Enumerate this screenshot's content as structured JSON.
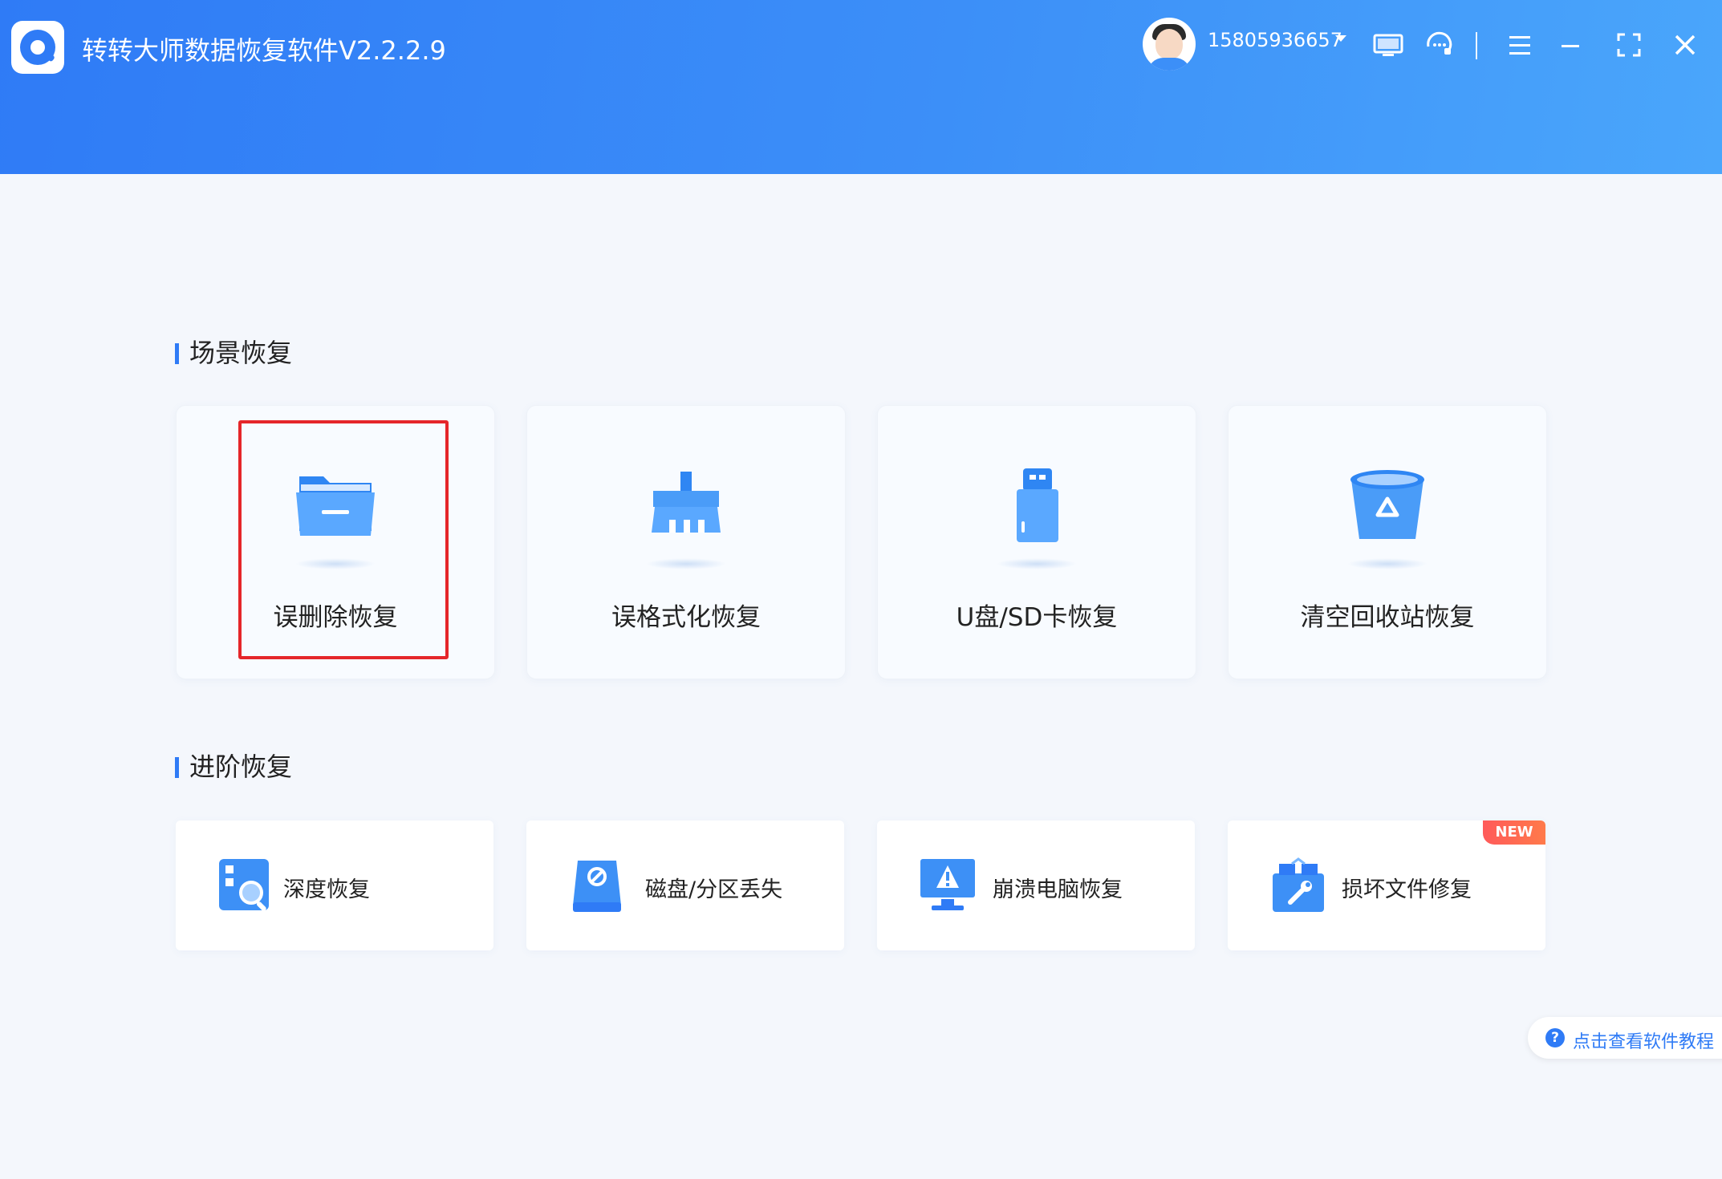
{
  "app": {
    "title": "转转大师数据恢复软件V2.2.2.9"
  },
  "user": {
    "phone": "15805936657"
  },
  "header_icons": [
    "monitor-icon",
    "support-chat-icon",
    "menu-icon",
    "minimize-icon",
    "fullscreen-icon",
    "close-icon"
  ],
  "sections": {
    "scene": {
      "title": "场景恢复"
    },
    "advanced": {
      "title": "进阶恢复"
    }
  },
  "scene_cards": [
    {
      "label": "误删除恢复",
      "icon": "folder-icon",
      "selected": true
    },
    {
      "label": "误格式化恢复",
      "icon": "broom-icon"
    },
    {
      "label": "U盘/SD卡恢复",
      "icon": "usb-drive-icon"
    },
    {
      "label": "清空回收站恢复",
      "icon": "recycle-bin-icon"
    }
  ],
  "advanced_cards": [
    {
      "label": "深度恢复",
      "icon": "deep-scan-icon"
    },
    {
      "label": "磁盘/分区丢失",
      "icon": "disk-icon"
    },
    {
      "label": "崩溃电脑恢复",
      "icon": "crashed-pc-icon"
    },
    {
      "label": "损坏文件修复",
      "icon": "file-repair-icon",
      "badge": "NEW"
    }
  ],
  "help": {
    "label": "点击查看软件教程",
    "icon": "?"
  },
  "colors": {
    "primary": "#2f7bf6",
    "highlight": "#e5262a",
    "badge": "#ff5a5a"
  }
}
